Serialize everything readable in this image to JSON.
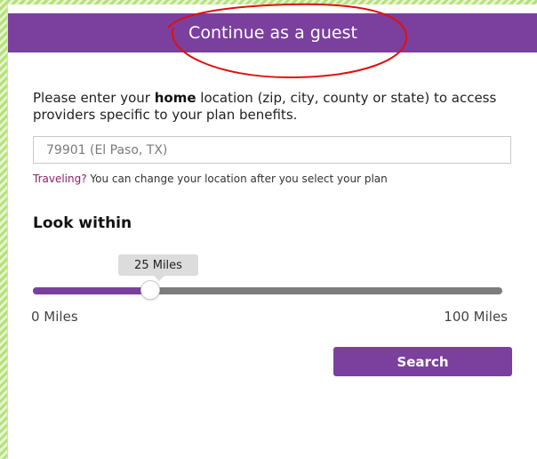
{
  "header": {
    "title": "Continue as a guest"
  },
  "intro": {
    "before": "Please enter your ",
    "emphasis": "home",
    "after": " location (zip, city, county or state) to access providers specific to your plan benefits."
  },
  "location": {
    "placeholder": "79901 (El Paso, TX)",
    "value": ""
  },
  "travel": {
    "link": "Traveling?",
    "text": " You can change your location after you select your plan"
  },
  "radius": {
    "heading": "Look within",
    "value_label": "25 Miles",
    "value": 25,
    "min": 0,
    "max": 100,
    "min_label": "0 Miles",
    "max_label": "100 Miles"
  },
  "actions": {
    "search_label": "Search"
  },
  "colors": {
    "brand": "#7b3f9e",
    "annotation": "#e01010"
  }
}
